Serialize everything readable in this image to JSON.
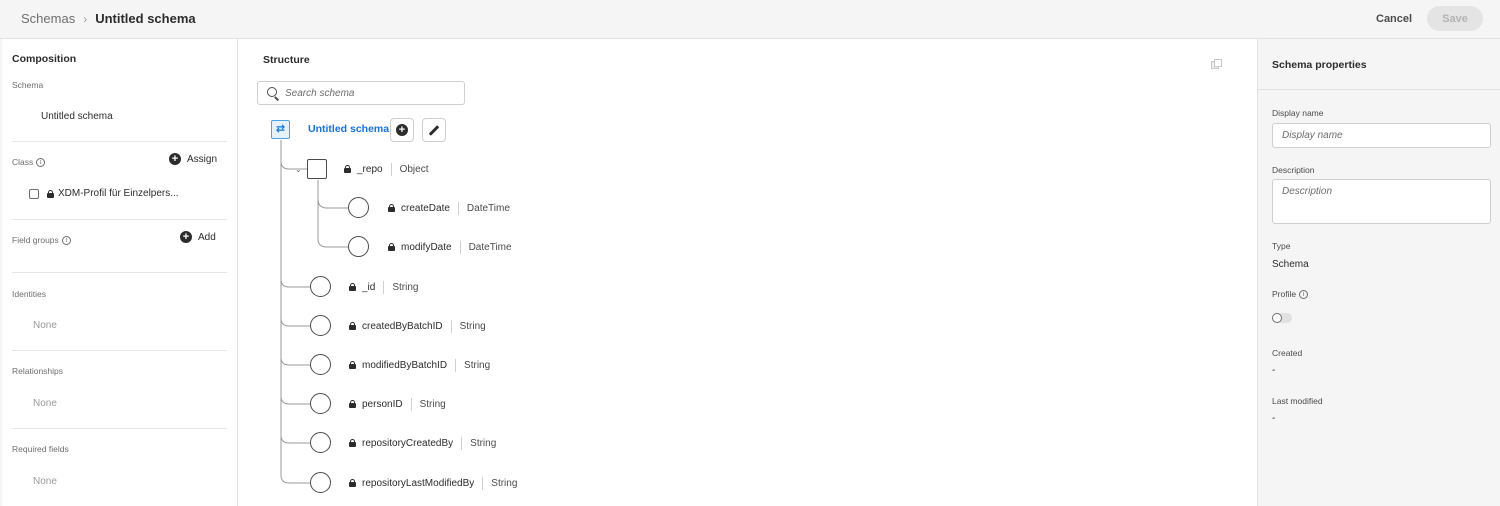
{
  "header": {
    "breadcrumb_root": "Schemas",
    "breadcrumb_current": "Untitled schema",
    "cancel_label": "Cancel",
    "save_label": "Save"
  },
  "composition": {
    "title": "Composition",
    "schema_label": "Schema",
    "schema_value": "Untitled schema",
    "class_label": "Class",
    "assign_label": "Assign",
    "class_item": "XDM-Profil für Einzelpers...",
    "field_groups_label": "Field groups",
    "add_label": "Add",
    "identities_label": "Identities",
    "identities_value": "None",
    "relationships_label": "Relationships",
    "relationships_value": "None",
    "required_label": "Required fields",
    "required_value": "None"
  },
  "structure": {
    "title": "Structure",
    "search_placeholder": "Search schema",
    "root_name": "Untitled schema",
    "fields": [
      {
        "name": "_repo",
        "type": "Object"
      },
      {
        "name": "createDate",
        "type": "DateTime"
      },
      {
        "name": "modifyDate",
        "type": "DateTime"
      },
      {
        "name": "_id",
        "type": "String"
      },
      {
        "name": "createdByBatchID",
        "type": "String"
      },
      {
        "name": "modifiedByBatchID",
        "type": "String"
      },
      {
        "name": "personID",
        "type": "String"
      },
      {
        "name": "repositoryCreatedBy",
        "type": "String"
      },
      {
        "name": "repositoryLastModifiedBy",
        "type": "String"
      }
    ]
  },
  "properties": {
    "title": "Schema properties",
    "display_name_label": "Display name",
    "display_name_placeholder": "Display name",
    "description_label": "Description",
    "description_placeholder": "Description",
    "type_label": "Type",
    "type_value": "Schema",
    "profile_label": "Profile",
    "profile_enabled": false,
    "created_label": "Created",
    "created_value": "-",
    "last_modified_label": "Last modified",
    "last_modified_value": "-"
  },
  "colors": {
    "accent": "#1473e6",
    "panel_bg": "#ffffff",
    "page_bg": "#f5f5f5"
  }
}
